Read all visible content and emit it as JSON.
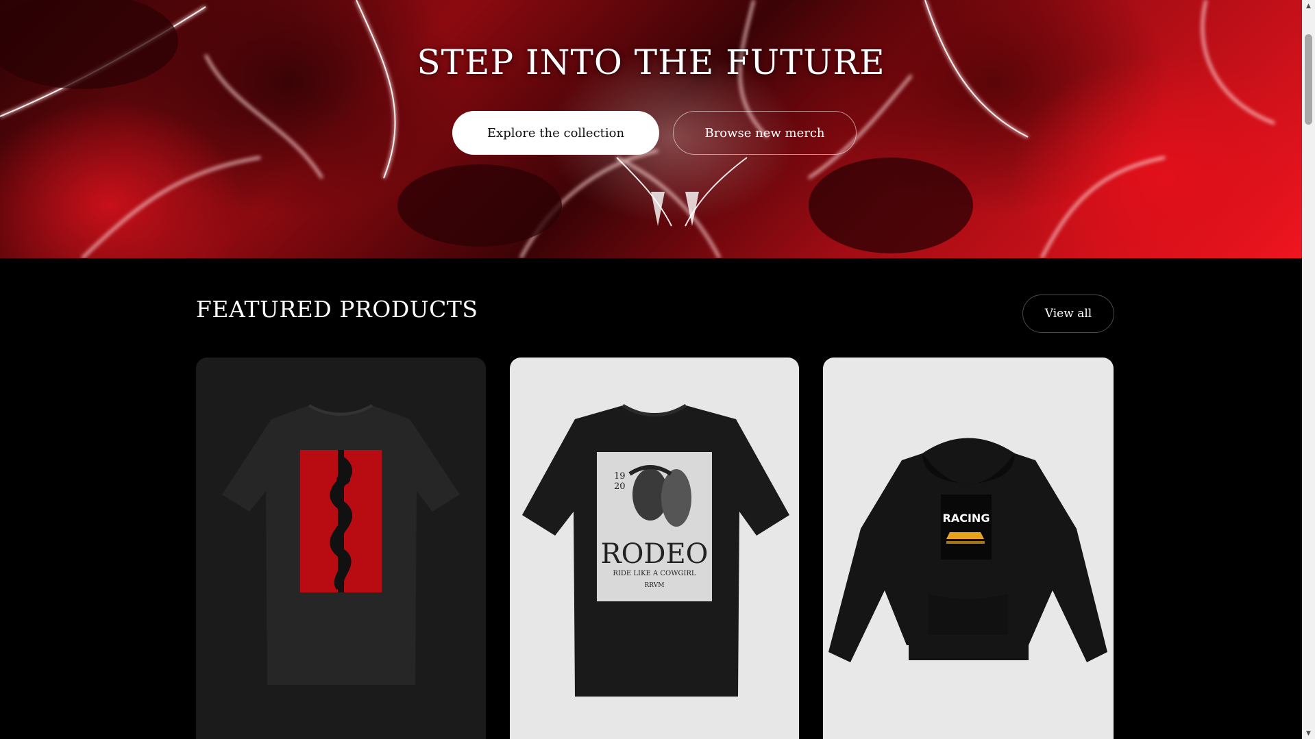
{
  "hero": {
    "title": "STEP INTO THE FUTURE",
    "primary_button": "Explore the collection",
    "secondary_button": "Browse new merch"
  },
  "featured": {
    "title": "FEATURED PRODUCTS",
    "view_all": "View all",
    "products": [
      {
        "graphic": "red-panel-snake-sword",
        "garment": "t-shirt",
        "background": "#1b1b1b"
      },
      {
        "graphic": "rodeo-cowgirl-horse",
        "garment": "t-shirt",
        "print": {
          "year_top": "19",
          "year_bottom": "20",
          "headline": "RODEO",
          "tagline": "RIDE LIKE A COWGIRL",
          "brand": "RRVM"
        },
        "background": "#e7e7e7"
      },
      {
        "graphic": "racing-car",
        "garment": "hoodie",
        "print": {
          "headline": "RACING"
        },
        "background": "#e8e8e8"
      }
    ]
  },
  "colors": {
    "accent_red": "#d1101a",
    "page_background": "#000000",
    "button_white": "#ffffff"
  },
  "icons": {
    "scroll_up": "scroll-up-arrow-icon",
    "scroll_down": "scroll-down-arrow-icon"
  }
}
